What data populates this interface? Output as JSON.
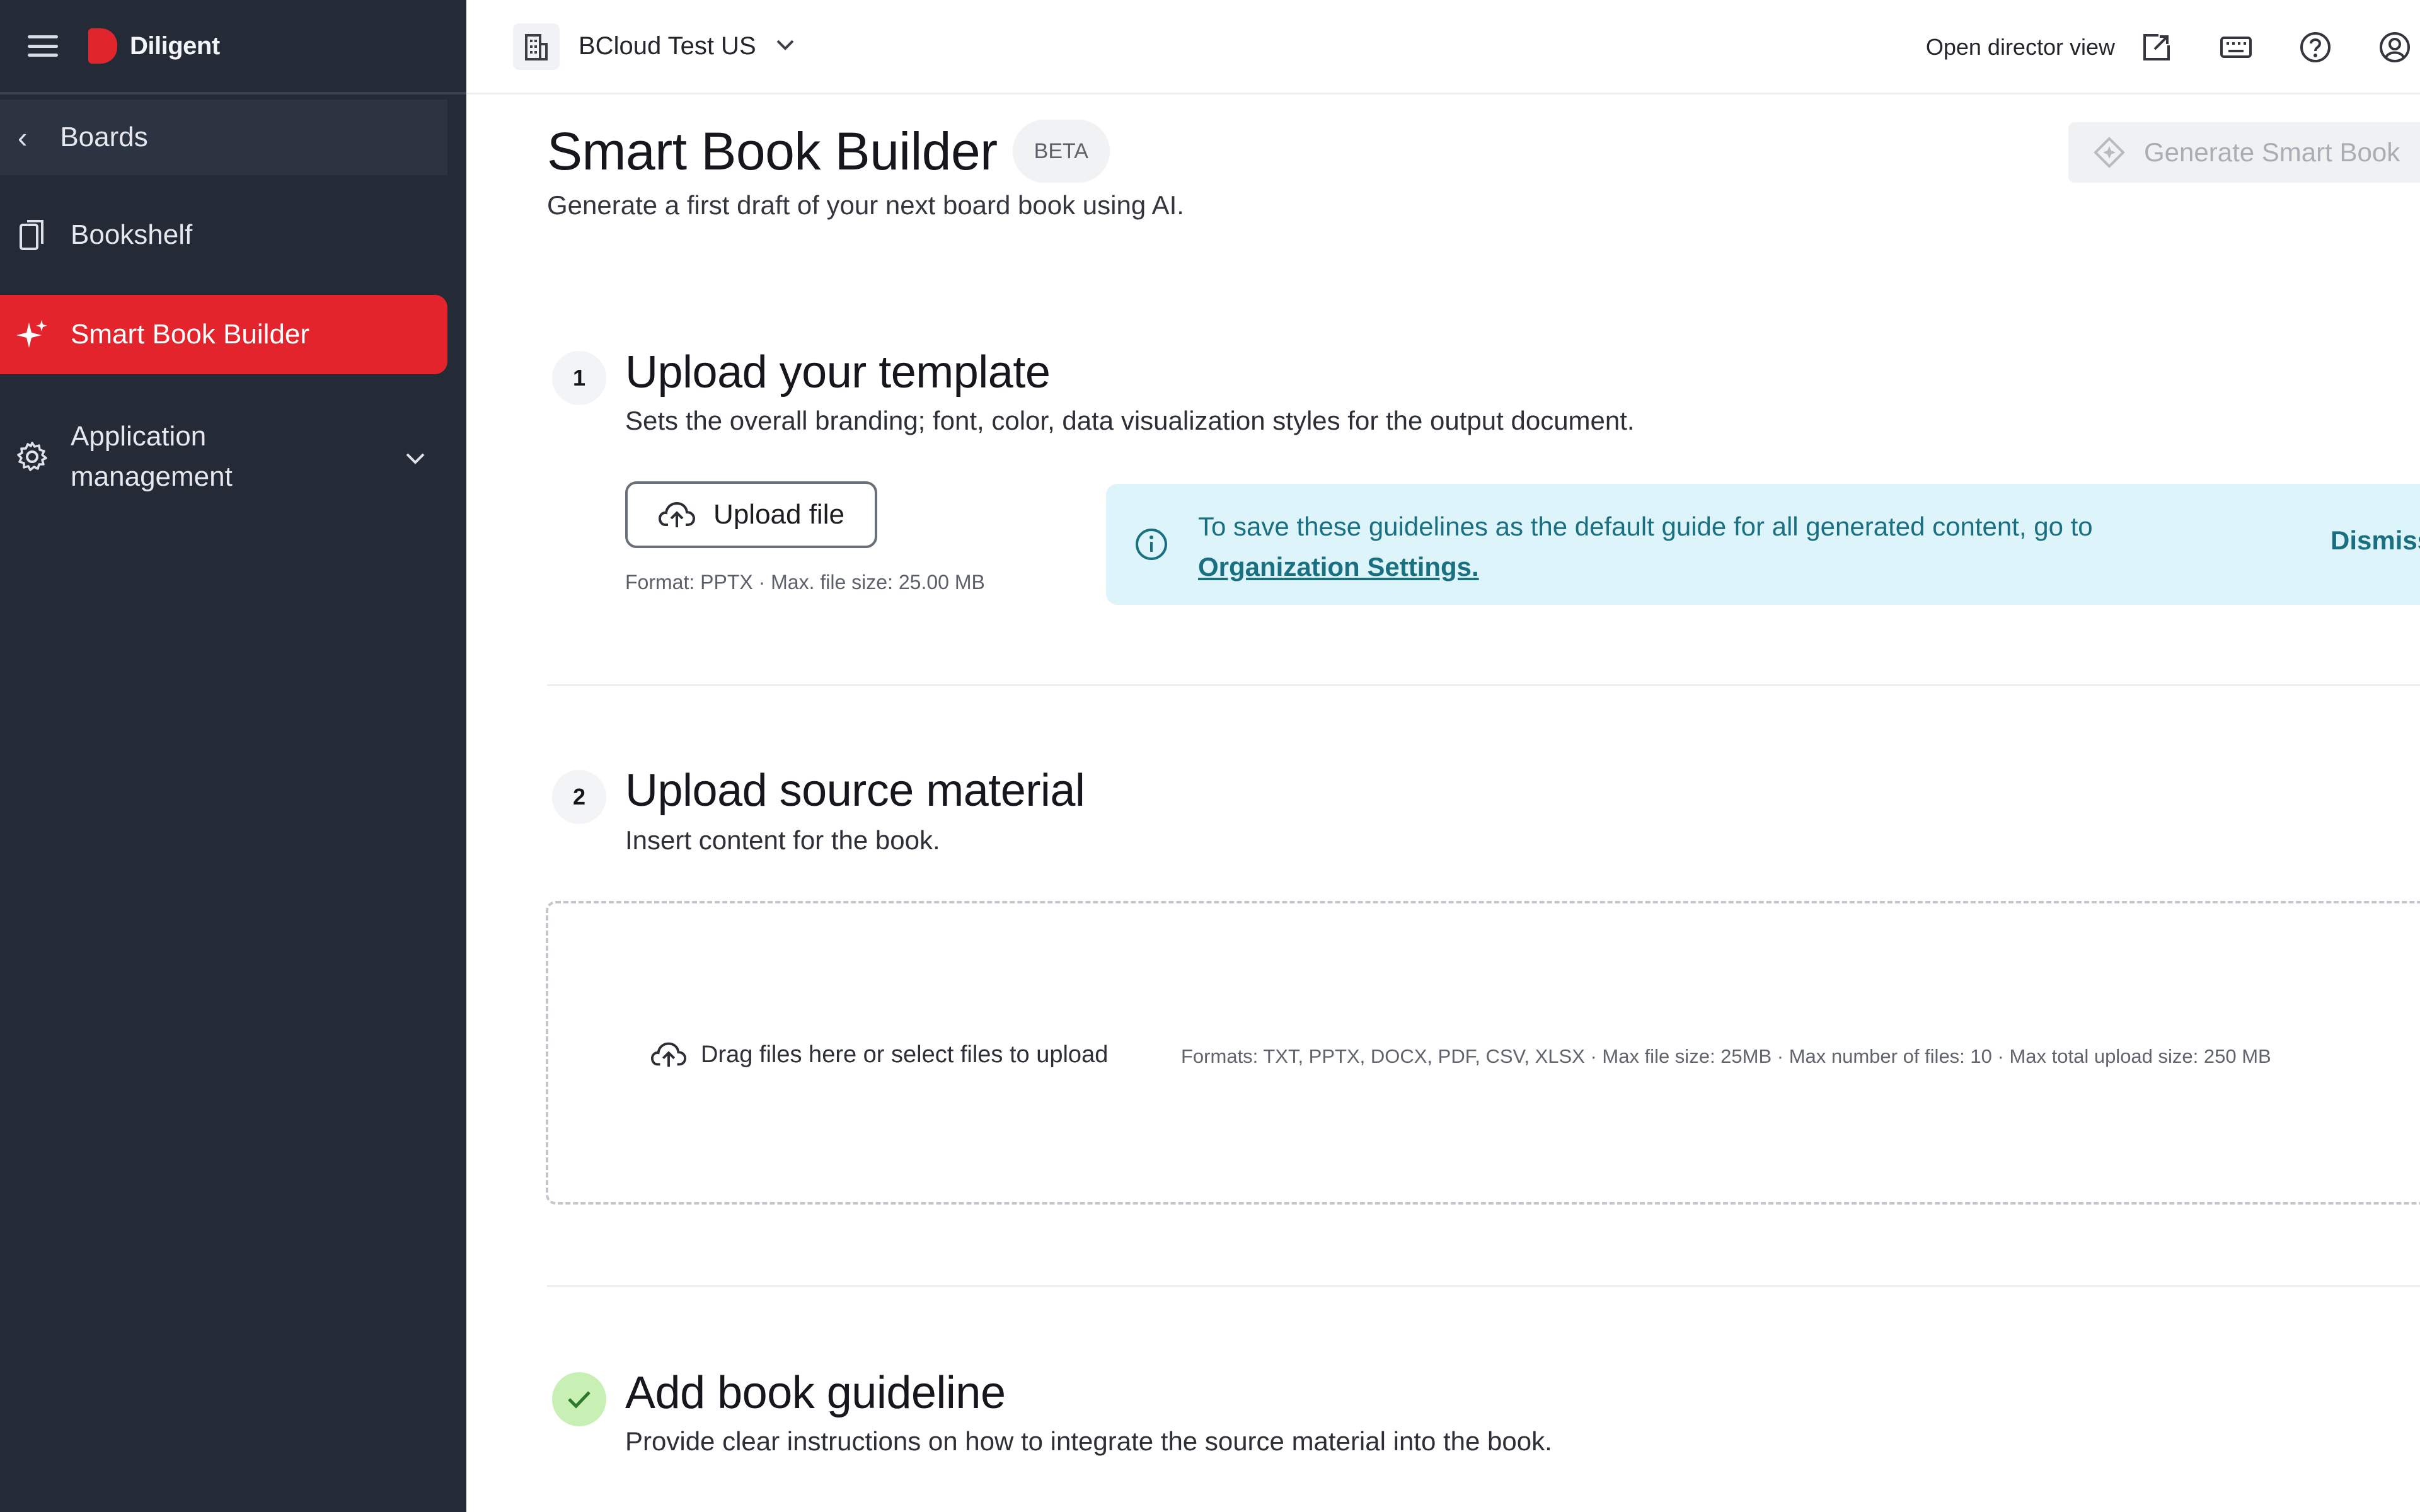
{
  "brand": {
    "name": "Diligent",
    "accent": "#e4242c",
    "sidebar_bg": "#242a36"
  },
  "sidebar": {
    "back_label": "Boards",
    "items": [
      {
        "label": "Bookshelf",
        "icon": "book-icon",
        "active": false
      },
      {
        "label": "Smart Book Builder",
        "icon": "sparkle-icon",
        "active": true
      },
      {
        "label": "Application management",
        "icon": "gear-icon",
        "active": false
      }
    ]
  },
  "header": {
    "org_name": "BCloud Test US",
    "director_view_label": "Open director view",
    "icons": [
      "external-link-icon",
      "keyboard-icon",
      "help-icon",
      "user-icon"
    ]
  },
  "page": {
    "title": "Smart Book Builder",
    "badge": "BETA",
    "subtitle": "Generate a first draft of your next board book using AI.",
    "generate_button": "Generate Smart Book"
  },
  "steps": [
    {
      "number": "1",
      "title": "Upload your template",
      "subtitle": "Sets the overall branding; font, color, data visualization styles for the output document.",
      "button": "Upload file",
      "hint": "Format: PPTX · Max. file size: 25.00 MB"
    },
    {
      "number": "2",
      "title": "Upload source material",
      "subtitle": "Insert content for the book.",
      "dropzone_label": "Drag files here or select files to upload",
      "dropzone_formats": "Formats: TXT, PPTX, DOCX, PDF, CSV, XLSX · Max file size: 25MB · Max number of files: 10 · Max total upload size: 250 MB"
    },
    {
      "number": "✓",
      "title": "Add book guideline",
      "subtitle": "Provide clear instructions on how to integrate the source material into the book."
    }
  ],
  "banner": {
    "text": "To save these guidelines as the default guide for all generated content, go to",
    "link": "Organization Settings.",
    "dismiss": "Dismiss"
  }
}
